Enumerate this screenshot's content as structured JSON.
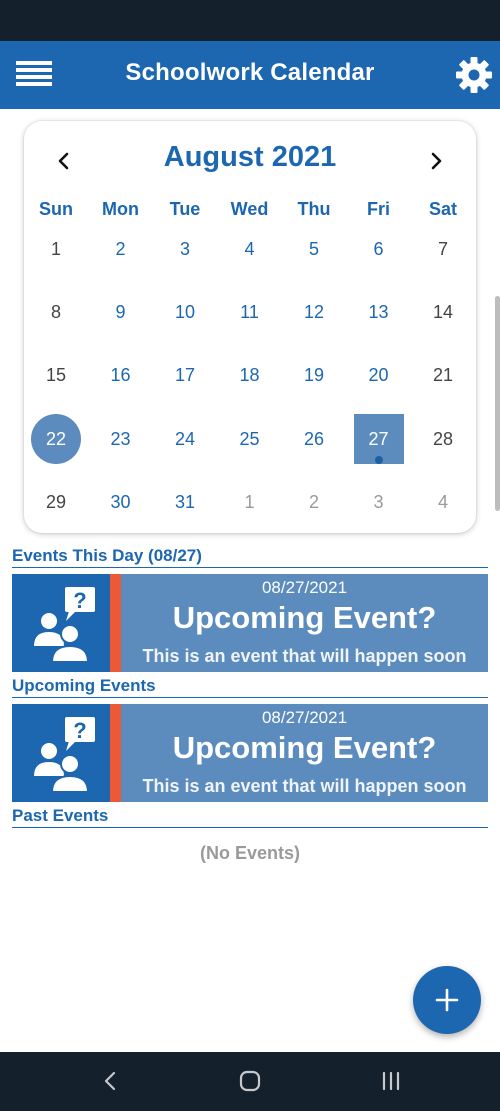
{
  "app": {
    "title": "Schoolwork Calendar"
  },
  "icons": {
    "menu": "hamburger-icon",
    "settings": "gear-icon",
    "prev": "chevron-left-icon",
    "next": "chevron-right-icon",
    "event": "people-question-icon",
    "fab": "plus-icon"
  },
  "colors": {
    "primary": "#1c67b0",
    "card": "#5b8cbd",
    "accent": "#ec5a35",
    "status": "#14202c"
  },
  "calendar": {
    "month_title": "August 2021",
    "weekdays": [
      "Sun",
      "Mon",
      "Tue",
      "Wed",
      "Thu",
      "Fri",
      "Sat"
    ],
    "weeks": [
      [
        "1",
        "2",
        "3",
        "4",
        "5",
        "6",
        "7"
      ],
      [
        "8",
        "9",
        "10",
        "11",
        "12",
        "13",
        "14"
      ],
      [
        "15",
        "16",
        "17",
        "18",
        "19",
        "20",
        "21"
      ],
      [
        "22",
        "23",
        "24",
        "25",
        "26",
        "27",
        "28"
      ],
      [
        "29",
        "30",
        "31",
        "1",
        "2",
        "3",
        "4"
      ]
    ],
    "today": "22",
    "selected": "27"
  },
  "sections": {
    "this_day": "Events This Day (08/27)",
    "upcoming": "Upcoming Events",
    "past": "Past Events"
  },
  "events_this_day": [
    {
      "date": "08/27/2021",
      "title": "Upcoming Event?",
      "description": "This is an event that will happen soon"
    }
  ],
  "upcoming_events": [
    {
      "date": "08/27/2021",
      "title": "Upcoming Event?",
      "description": "This is an event that will happen soon"
    }
  ],
  "past_events": {
    "empty_text": "(No Events)"
  }
}
